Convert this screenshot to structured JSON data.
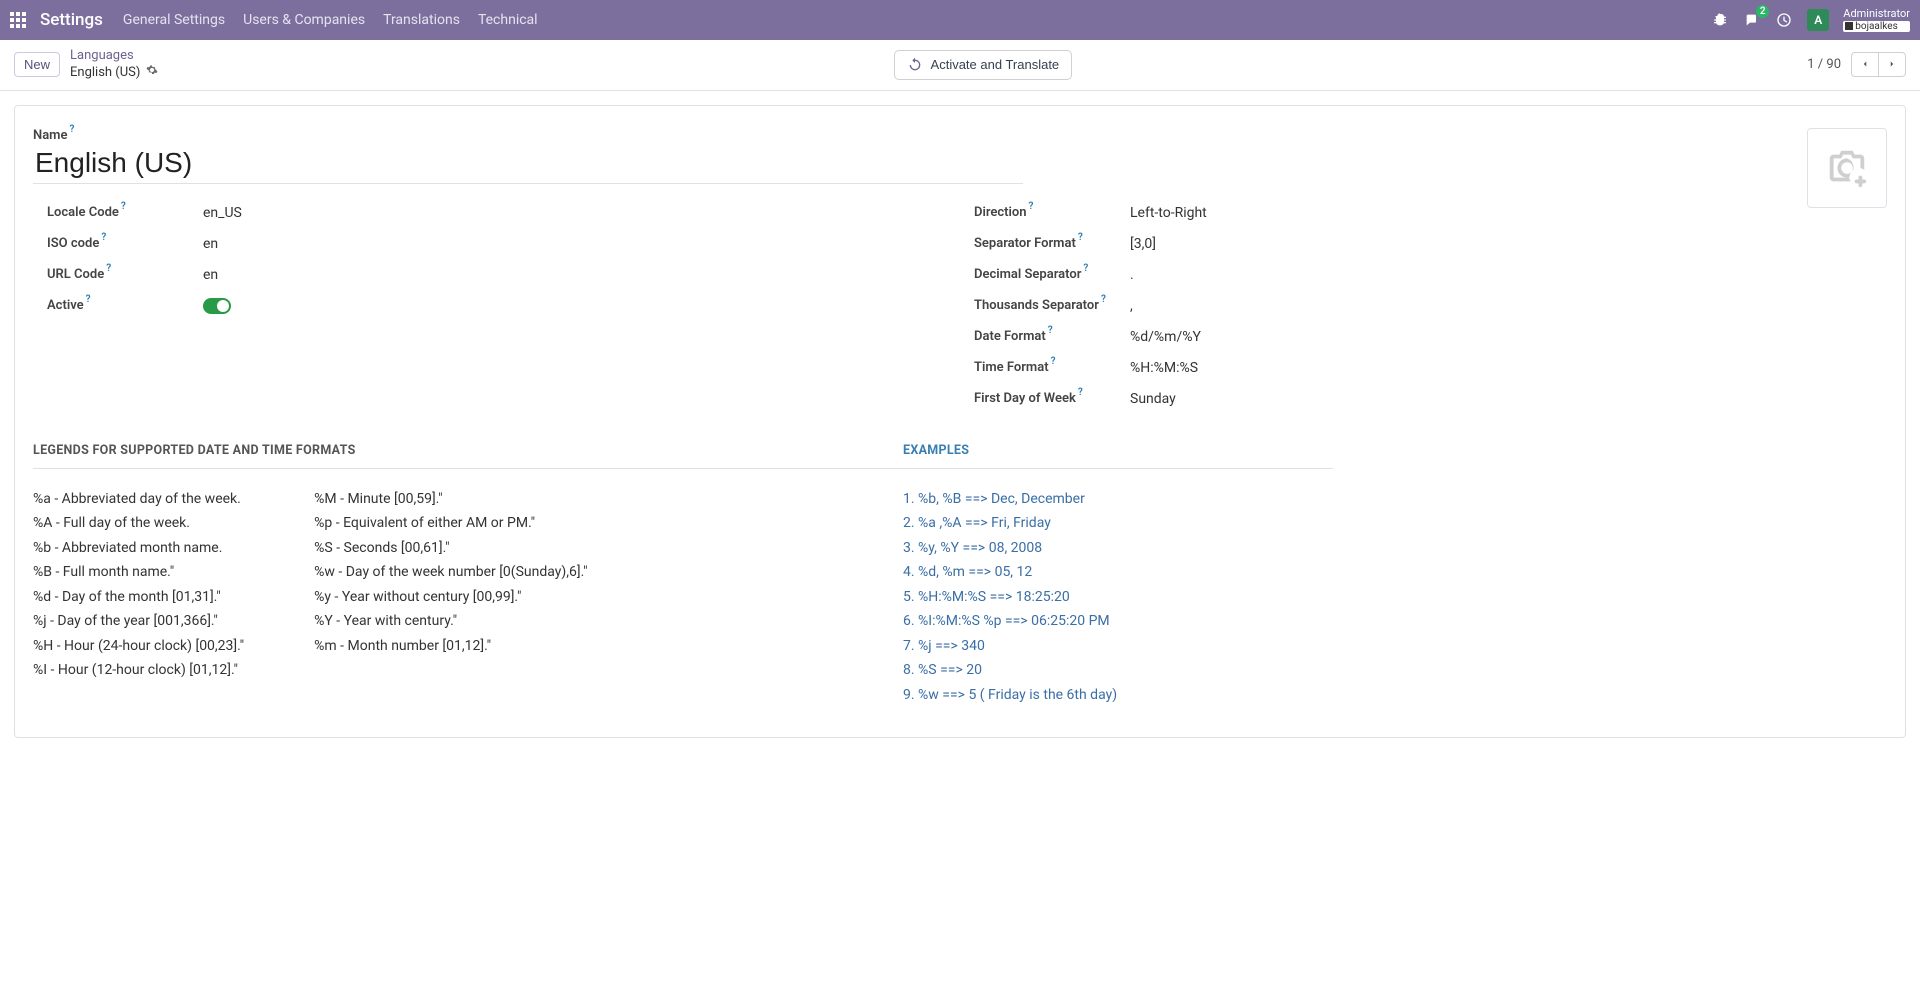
{
  "header": {
    "app_title": "Settings",
    "nav": [
      "General Settings",
      "Users & Companies",
      "Translations",
      "Technical"
    ],
    "chat_badge": "2",
    "avatar_letter": "A",
    "user_name": "Administrator",
    "user_sub": "bojaalkes"
  },
  "control": {
    "new_label": "New",
    "breadcrumb_parent": "Languages",
    "breadcrumb_current": "English (US)",
    "activate_label": "Activate and Translate",
    "pager": "1 / 90"
  },
  "form": {
    "name_label": "Name",
    "name_value": "English (US)",
    "left": {
      "locale_code_label": "Locale Code",
      "locale_code_value": "en_US",
      "iso_code_label": "ISO code",
      "iso_code_value": "en",
      "url_code_label": "URL Code",
      "url_code_value": "en",
      "active_label": "Active"
    },
    "right": {
      "direction_label": "Direction",
      "direction_value": "Left-to-Right",
      "sep_format_label": "Separator Format",
      "sep_format_value": "[3,0]",
      "dec_sep_label": "Decimal Separator",
      "dec_sep_value": ".",
      "thou_sep_label": "Thousands Separator",
      "thou_sep_value": ",",
      "date_fmt_label": "Date Format",
      "date_fmt_value": "%d/%m/%Y",
      "time_fmt_label": "Time Format",
      "time_fmt_value": "%H:%M:%S",
      "first_dow_label": "First Day of Week",
      "first_dow_value": "Sunday"
    }
  },
  "tabs": {
    "legends_title": "LEGENDS FOR SUPPORTED DATE AND TIME FORMATS",
    "examples_title": "EXAMPLES"
  },
  "legends": {
    "col1": [
      "%a - Abbreviated day of the week.",
      "%A - Full day of the week.",
      "%b - Abbreviated month name.",
      "%B - Full month name.\"",
      "%d - Day of the month [01,31].\"",
      "%j - Day of the year [001,366].\"",
      "%H - Hour (24-hour clock) [00,23].\"",
      "%I - Hour (12-hour clock) [01,12].\""
    ],
    "col2": [
      "%M - Minute [00,59].\"",
      "%p - Equivalent of either AM or PM.\"",
      "%S - Seconds [00,61].\"",
      "%w - Day of the week number [0(Sunday),6].\"",
      "%y - Year without century [00,99].\"",
      "%Y - Year with century.\"",
      "%m - Month number [01,12].\""
    ]
  },
  "examples": [
    "1. %b, %B ==> Dec, December",
    "2. %a ,%A ==> Fri, Friday",
    "3. %y, %Y ==> 08, 2008",
    "4. %d, %m ==> 05, 12",
    "5. %H:%M:%S ==> 18:25:20",
    "6. %I:%M:%S %p ==> 06:25:20 PM",
    "7. %j ==> 340",
    "8. %S ==> 20",
    "9. %w ==> 5 ( Friday is the 6th day)"
  ]
}
